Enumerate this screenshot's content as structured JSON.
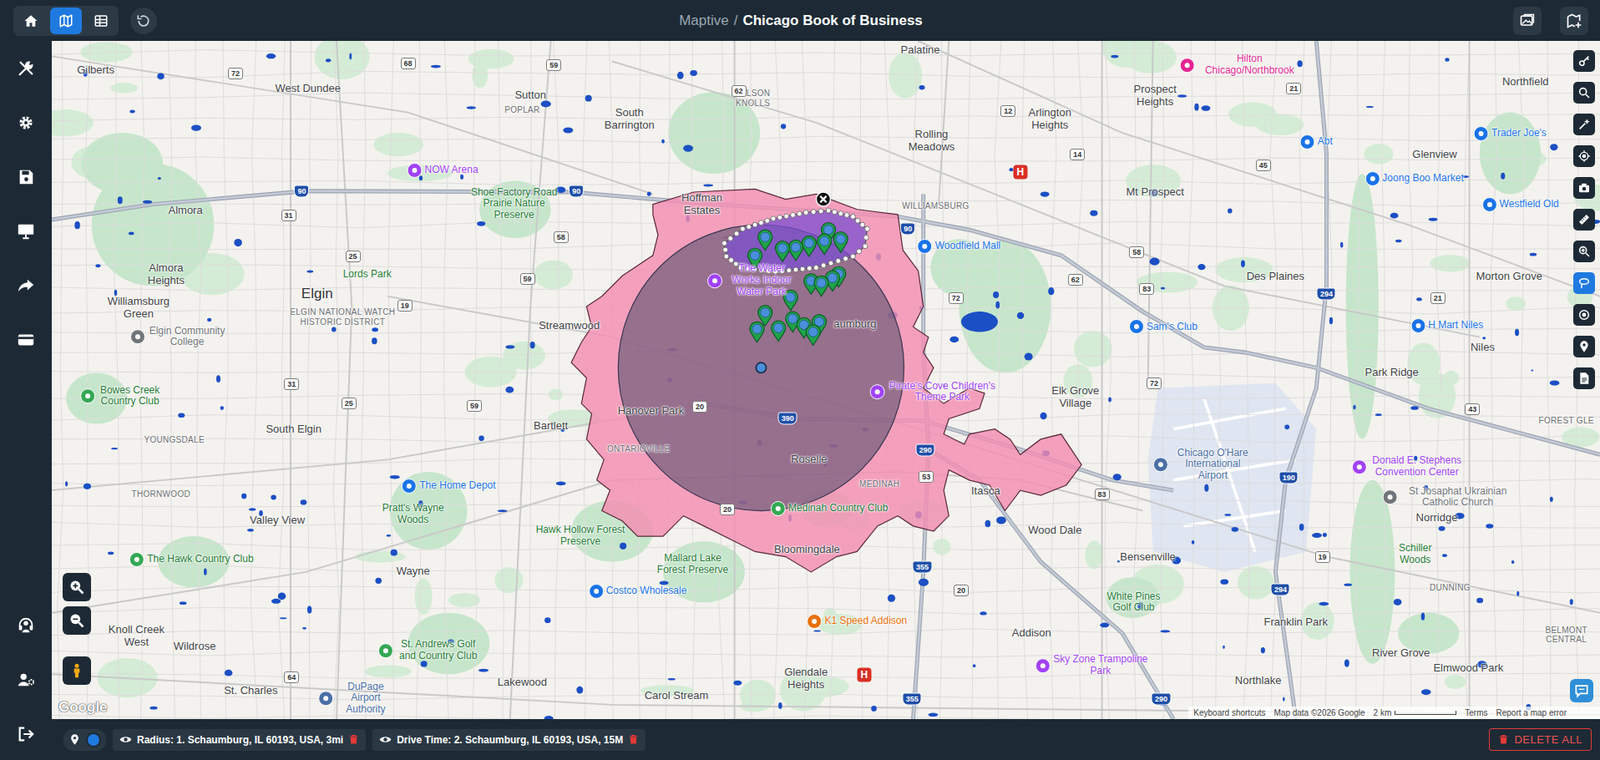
{
  "header": {
    "brand": "Maptive",
    "separator": "/",
    "title": "Chicago Book of Business",
    "view_tabs": [
      {
        "selected": false
      },
      {
        "selected": true
      },
      {
        "selected": false
      }
    ]
  },
  "map": {
    "places": [
      {
        "text": "Gilberts",
        "kind": "town"
      },
      {
        "text": "West Dundee",
        "kind": "town"
      },
      {
        "text": "Sutton",
        "kind": "town"
      },
      {
        "text": "South Barrington",
        "kind": "town"
      },
      {
        "text": "Palatine",
        "kind": "town"
      },
      {
        "text": "Arlington Heights",
        "kind": "town"
      },
      {
        "text": "Prospect Heights",
        "kind": "town"
      },
      {
        "text": "Northfield",
        "kind": "town"
      },
      {
        "text": "Rolling Meadows",
        "kind": "town"
      },
      {
        "text": "Mt Prospect",
        "kind": "town"
      },
      {
        "text": "Glenview",
        "kind": "town"
      },
      {
        "text": "Almora",
        "kind": "town"
      },
      {
        "text": "Almora Heights",
        "kind": "town"
      },
      {
        "text": "Elgin",
        "kind": "city"
      },
      {
        "text": "Williamsburg Green",
        "kind": "town"
      },
      {
        "text": "South Elgin",
        "kind": "town"
      },
      {
        "text": "Valley View",
        "kind": "town"
      },
      {
        "text": "Wayne",
        "kind": "town"
      },
      {
        "text": "Knoll Creek West",
        "kind": "town"
      },
      {
        "text": "Wildrose",
        "kind": "town"
      },
      {
        "text": "St. Charles",
        "kind": "town"
      },
      {
        "text": "Lakewood",
        "kind": "town"
      },
      {
        "text": "Streamwood",
        "kind": "town"
      },
      {
        "text": "Bartlett",
        "kind": "town"
      },
      {
        "text": "Hanover Park",
        "kind": "town"
      },
      {
        "text": "Roselle",
        "kind": "town"
      },
      {
        "text": "Bloomingdale",
        "kind": "town"
      },
      {
        "text": "Carol Stream",
        "kind": "town"
      },
      {
        "text": "Glendale Heights",
        "kind": "town"
      },
      {
        "text": "Itasca",
        "kind": "town"
      },
      {
        "text": "Wood Dale",
        "kind": "town"
      },
      {
        "text": "Bensenville",
        "kind": "town"
      },
      {
        "text": "Addison",
        "kind": "town"
      },
      {
        "text": "Franklin Park",
        "kind": "town"
      },
      {
        "text": "Northlake",
        "kind": "town"
      },
      {
        "text": "River Grove",
        "kind": "town"
      },
      {
        "text": "Elmwood Park",
        "kind": "town"
      },
      {
        "text": "Norridge",
        "kind": "town"
      },
      {
        "text": "Des Plaines",
        "kind": "town"
      },
      {
        "text": "Niles",
        "kind": "town"
      },
      {
        "text": "Park Ridge",
        "kind": "town"
      },
      {
        "text": "Morton Grove",
        "kind": "town"
      },
      {
        "text": "Elk Grove Village",
        "kind": "town"
      },
      {
        "text": "Hoffman Estates",
        "kind": "town"
      },
      {
        "text": "aumburg",
        "kind": "town"
      },
      {
        "text": "POPLAR",
        "kind": "small"
      },
      {
        "text": "WILSON KNOLLS",
        "kind": "small"
      },
      {
        "text": "YOUNGSDALE",
        "kind": "small"
      },
      {
        "text": "THORNWOOD",
        "kind": "small"
      },
      {
        "text": "ONTARIOVILLE",
        "kind": "small"
      },
      {
        "text": "MEDINAH",
        "kind": "small"
      },
      {
        "text": "WILLIAMSBURG",
        "kind": "small"
      },
      {
        "text": "DUNNING",
        "kind": "small"
      },
      {
        "text": "BELMONT CENTRAL",
        "kind": "small"
      },
      {
        "text": "ELGIN NATIONAL WATCH HISTORIC DISTRICT",
        "kind": "small"
      },
      {
        "text": "FOREST GLE",
        "kind": "small"
      },
      {
        "text": "Lords Park",
        "kind": "park"
      },
      {
        "text": "Bowes Creek Country Club",
        "kind": "golf"
      },
      {
        "text": "The Hawk Country Club",
        "kind": "golf"
      },
      {
        "text": "St. Andrews Golf and Country Club",
        "kind": "golf"
      },
      {
        "text": "Medinah Country Club",
        "kind": "golf"
      },
      {
        "text": "White Pines Golf Club",
        "kind": "park"
      },
      {
        "text": "Shoe Factory Road Prairie Nature Preserve",
        "kind": "park"
      },
      {
        "text": "Pratt's Wayne Woods",
        "kind": "park"
      },
      {
        "text": "Hawk Hollow Forest Preserve",
        "kind": "park"
      },
      {
        "text": "Mallard Lake Forest Preserve",
        "kind": "park"
      },
      {
        "text": "Schiller Woods",
        "kind": "park"
      },
      {
        "text": "NOW Arena",
        "kind": "poi",
        "color": "#a142f4"
      },
      {
        "text": "Hilton Chicago/Northbrook",
        "kind": "poi",
        "color": "#e52592"
      },
      {
        "text": "Abt",
        "kind": "poi",
        "color": "#1a73e8"
      },
      {
        "text": "Trader Joe's",
        "kind": "poi",
        "color": "#1a73e8"
      },
      {
        "text": "Joong Boo Market",
        "kind": "poi",
        "color": "#1a73e8"
      },
      {
        "text": "Westfield Old",
        "kind": "poi",
        "color": "#1a73e8"
      },
      {
        "text": "Woodfield Mall",
        "kind": "poi",
        "color": "#1a73e8"
      },
      {
        "text": "The Water Works Indoor Water Park",
        "kind": "poi",
        "color": "#a142f4"
      },
      {
        "text": "Sam's Club",
        "kind": "poi",
        "color": "#1a73e8"
      },
      {
        "text": "H Mart Niles",
        "kind": "poi",
        "color": "#1a73e8"
      },
      {
        "text": "Pirate's Cove Children's Theme Park",
        "kind": "poi",
        "color": "#a142f4"
      },
      {
        "text": "The Home Depot",
        "kind": "poi",
        "color": "#1a73e8"
      },
      {
        "text": "Costco Wholesale",
        "kind": "poi",
        "color": "#1a73e8"
      },
      {
        "text": "K1 Speed Addison",
        "kind": "poi",
        "color": "#e8710a"
      },
      {
        "text": "Sky Zone Trampoline Park",
        "kind": "poi",
        "color": "#a142f4"
      },
      {
        "text": "Donald E. Stephens Convention Center",
        "kind": "poi",
        "color": "#a142f4"
      },
      {
        "text": "St Josaphat Ukrainian Catholic Church",
        "kind": "poi",
        "color": "#70757a"
      },
      {
        "text": "Chicago O'Hare International Airport",
        "kind": "poi",
        "color": "#4a6fa5"
      },
      {
        "text": "Elgin Community College",
        "kind": "poi",
        "color": "#70757a"
      },
      {
        "text": "DuPage Airport Authority",
        "kind": "poi",
        "color": "#4a6fa5"
      },
      {
        "text": "H",
        "kind": "hospital"
      },
      {
        "text": "H",
        "kind": "hospital"
      },
      {
        "text": "72",
        "kind": "shield"
      },
      {
        "text": "68",
        "kind": "shield"
      },
      {
        "text": "59",
        "kind": "shield"
      },
      {
        "text": "62",
        "kind": "shield"
      },
      {
        "text": "90",
        "kind": "interstate"
      },
      {
        "text": "90",
        "kind": "interstate"
      },
      {
        "text": "90",
        "kind": "interstate"
      },
      {
        "text": "31",
        "kind": "shield"
      },
      {
        "text": "25",
        "kind": "shield"
      },
      {
        "text": "58",
        "kind": "shield"
      },
      {
        "text": "59",
        "kind": "shield"
      },
      {
        "text": "19",
        "kind": "shield"
      },
      {
        "text": "31",
        "kind": "shield"
      },
      {
        "text": "25",
        "kind": "shield"
      },
      {
        "text": "59",
        "kind": "shield"
      },
      {
        "text": "20",
        "kind": "shield"
      },
      {
        "text": "390",
        "kind": "interstate"
      },
      {
        "text": "290",
        "kind": "interstate"
      },
      {
        "text": "72",
        "kind": "shield"
      },
      {
        "text": "53",
        "kind": "shield"
      },
      {
        "text": "20",
        "kind": "shield"
      },
      {
        "text": "355",
        "kind": "interstate"
      },
      {
        "text": "20",
        "kind": "shield"
      },
      {
        "text": "83",
        "kind": "shield"
      },
      {
        "text": "290",
        "kind": "interstate"
      },
      {
        "text": "19",
        "kind": "shield"
      },
      {
        "text": "294",
        "kind": "interstate"
      },
      {
        "text": "190",
        "kind": "interstate"
      },
      {
        "text": "72",
        "kind": "shield"
      },
      {
        "text": "83",
        "kind": "shield"
      },
      {
        "text": "62",
        "kind": "shield"
      },
      {
        "text": "14",
        "kind": "shield"
      },
      {
        "text": "12",
        "kind": "shield"
      },
      {
        "text": "58",
        "kind": "shield"
      },
      {
        "text": "45",
        "kind": "shield"
      },
      {
        "text": "21",
        "kind": "shield"
      },
      {
        "text": "294",
        "kind": "interstate"
      },
      {
        "text": "21",
        "kind": "shield"
      },
      {
        "text": "43",
        "kind": "shield"
      },
      {
        "text": "64",
        "kind": "shield"
      },
      {
        "text": "355",
        "kind": "interstate"
      }
    ],
    "tools": [
      {
        "selected": false
      },
      {
        "selected": false
      },
      {
        "selected": false
      },
      {
        "selected": false
      },
      {
        "selected": false
      },
      {
        "selected": false
      },
      {
        "selected": false
      },
      {
        "selected": true
      },
      {
        "selected": false
      },
      {
        "selected": false
      },
      {
        "selected": false
      }
    ],
    "attribution": {
      "logo": "Google",
      "shortcuts": "Keyboard shortcuts",
      "data": "Map data ©2026 Google",
      "scale": "2 km",
      "terms": "Terms",
      "report": "Report a map error"
    }
  },
  "bottom_bar": {
    "markers_toggle": {
      "on": true
    },
    "layers": [
      {
        "label": "Radius: 1. Schaumburg, IL 60193, USA, 3mi",
        "visible": true
      },
      {
        "label": "Drive Time: 2. Schaumburg, IL 60193, USA, 15M",
        "visible": true
      }
    ],
    "delete_all": "DELETE ALL"
  }
}
